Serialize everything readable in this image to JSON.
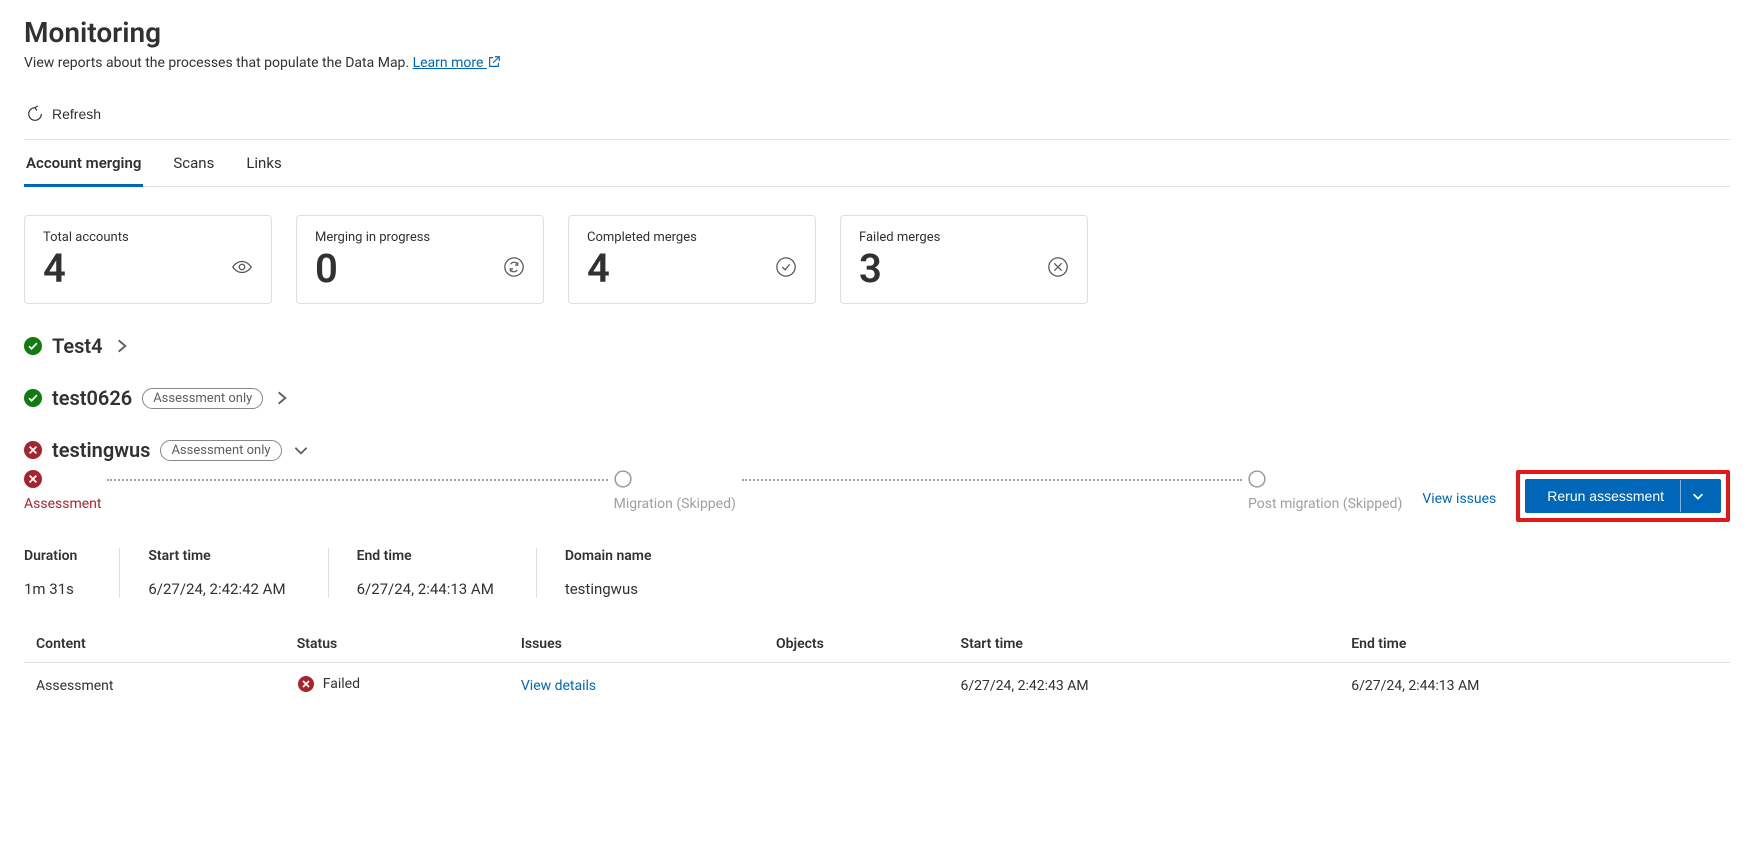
{
  "page": {
    "title": "Monitoring",
    "subtitle_pre": "View reports about the processes that populate the Data Map. ",
    "learn_more": "Learn more"
  },
  "toolbar": {
    "refresh": "Refresh"
  },
  "tabs": [
    {
      "label": "Account merging",
      "active": true
    },
    {
      "label": "Scans",
      "active": false
    },
    {
      "label": "Links",
      "active": false
    }
  ],
  "cards": [
    {
      "label": "Total accounts",
      "value": "4",
      "icon": "eye"
    },
    {
      "label": "Merging in progress",
      "value": "0",
      "icon": "sync"
    },
    {
      "label": "Completed merges",
      "value": "4",
      "icon": "check"
    },
    {
      "label": "Failed merges",
      "value": "3",
      "icon": "x"
    }
  ],
  "accounts": [
    {
      "name": "Test4",
      "status": "success",
      "pill": null,
      "expanded": false
    },
    {
      "name": "test0626",
      "status": "success",
      "pill": "Assessment only",
      "expanded": false
    },
    {
      "name": "testingwus",
      "status": "error",
      "pill": "Assessment only",
      "expanded": true
    }
  ],
  "steps": [
    {
      "label": "Assessment",
      "state": "fail"
    },
    {
      "label": "Migration (Skipped)",
      "state": "skipped"
    },
    {
      "label": "Post migration (Skipped)",
      "state": "skipped"
    }
  ],
  "actions": {
    "view_issues": "View issues",
    "rerun": "Rerun assessment"
  },
  "meta": {
    "duration_label": "Duration",
    "duration_value": "1m 31s",
    "start_label": "Start time",
    "start_value": "6/27/24, 2:42:42 AM",
    "end_label": "End time",
    "end_value": "6/27/24, 2:44:13 AM",
    "domain_label": "Domain name",
    "domain_value": "testingwus"
  },
  "table": {
    "headers": [
      "Content",
      "Status",
      "Issues",
      "Objects",
      "Start time",
      "End time"
    ],
    "rows": [
      {
        "content": "Assessment",
        "status_text": "Failed",
        "status": "error",
        "issues_link": "View details",
        "objects": "",
        "start": "6/27/24, 2:42:43 AM",
        "end": "6/27/24, 2:44:13 AM"
      }
    ]
  }
}
